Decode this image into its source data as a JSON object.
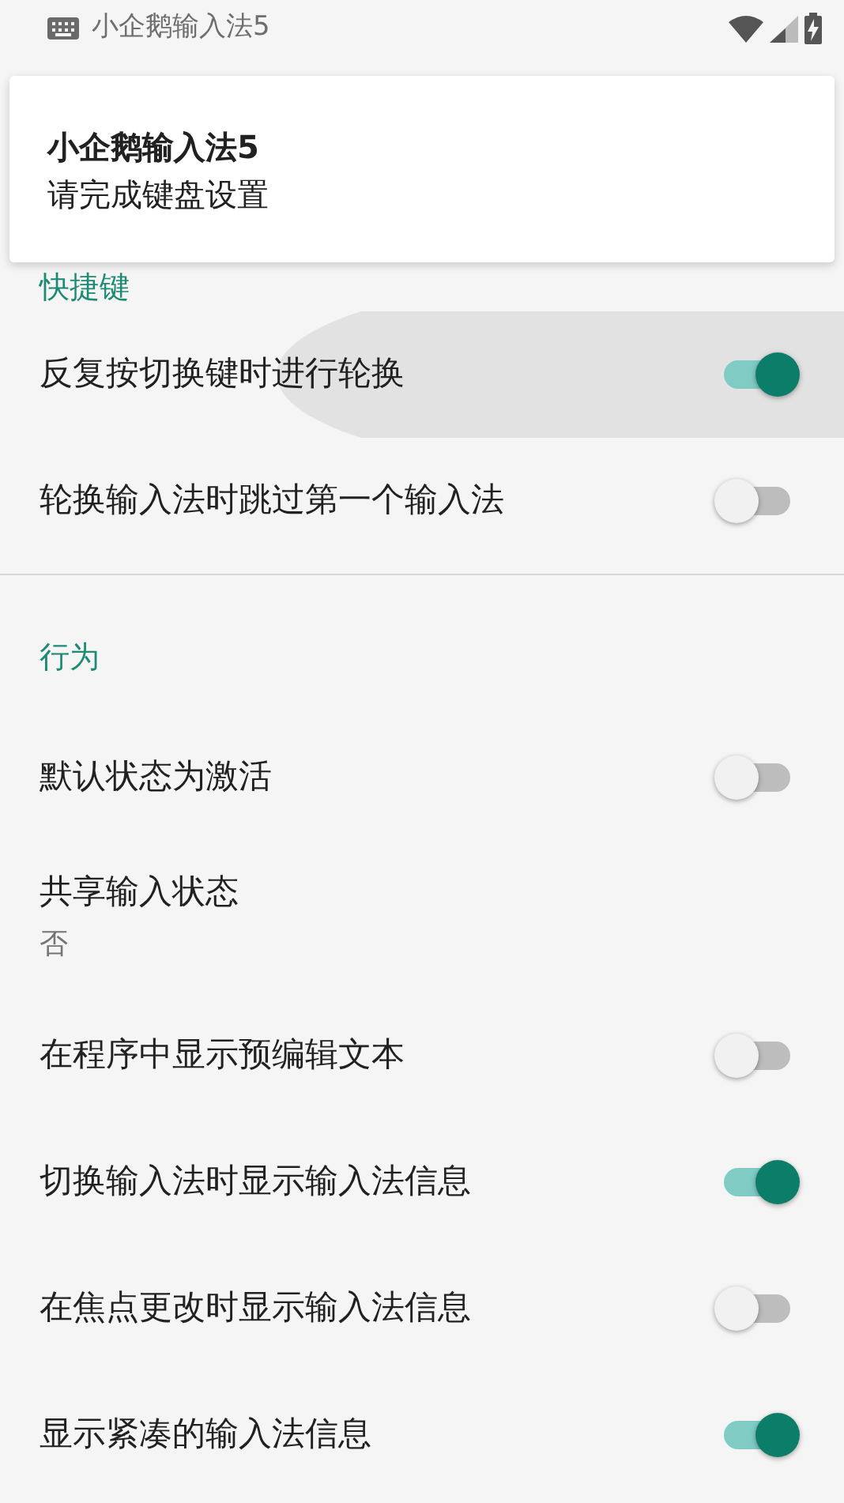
{
  "status_bar": {
    "notification_title": "小企鹅输入法5"
  },
  "notification": {
    "title": "小企鹅输入法5",
    "text": "请完成键盘设置"
  },
  "sections": [
    {
      "title": "快捷键",
      "items": [
        {
          "kind": "switch",
          "label": "反复按切换键时进行轮换",
          "on": true,
          "pressed": true
        },
        {
          "kind": "switch",
          "label": "轮换输入法时跳过第一个输入法",
          "on": false,
          "pressed": false
        }
      ]
    },
    {
      "title": "行为",
      "items": [
        {
          "kind": "switch",
          "label": "默认状态为激活",
          "on": false,
          "pressed": false
        },
        {
          "kind": "value",
          "label": "共享输入状态",
          "summary": "否",
          "pressed": false
        },
        {
          "kind": "switch",
          "label": "在程序中显示预编辑文本",
          "on": false,
          "pressed": false
        },
        {
          "kind": "switch",
          "label": "切换输入法时显示输入法信息",
          "on": true,
          "pressed": false
        },
        {
          "kind": "switch",
          "label": "在焦点更改时显示输入法信息",
          "on": false,
          "pressed": false
        },
        {
          "kind": "switch",
          "label": "显示紧凑的输入法信息",
          "on": true,
          "pressed": false
        }
      ]
    }
  ]
}
